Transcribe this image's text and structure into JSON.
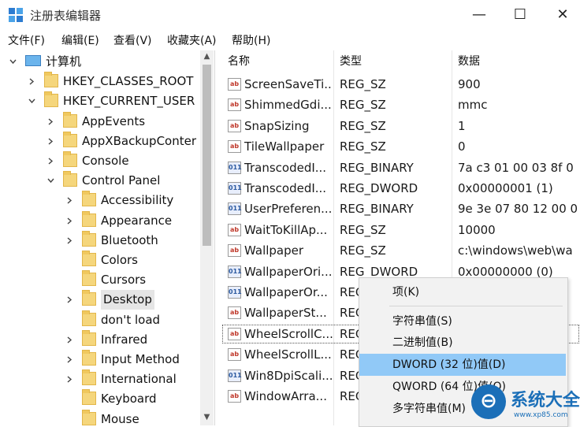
{
  "window": {
    "title": "注册表编辑器",
    "minimize": "—",
    "maximize": "☐",
    "close": "✕"
  },
  "menu": [
    "文件(F)",
    "编辑(E)",
    "查看(V)",
    "收藏夹(A)",
    "帮助(H)"
  ],
  "tree": [
    {
      "label": "计算机",
      "level": 0,
      "toggle": "expanded"
    },
    {
      "label": "HKEY_CLASSES_ROOT",
      "level": 1,
      "toggle": "collapsed"
    },
    {
      "label": "HKEY_CURRENT_USER",
      "level": 1,
      "toggle": "expanded"
    },
    {
      "label": "AppEvents",
      "level": 2,
      "toggle": "collapsed"
    },
    {
      "label": "AppXBackupConter",
      "level": 2,
      "toggle": "collapsed"
    },
    {
      "label": "Console",
      "level": 2,
      "toggle": "collapsed"
    },
    {
      "label": "Control Panel",
      "level": 2,
      "toggle": "expanded"
    },
    {
      "label": "Accessibility",
      "level": 3,
      "toggle": "collapsed"
    },
    {
      "label": "Appearance",
      "level": 3,
      "toggle": "collapsed"
    },
    {
      "label": "Bluetooth",
      "level": 3,
      "toggle": "collapsed"
    },
    {
      "label": "Colors",
      "level": 3,
      "toggle": "none"
    },
    {
      "label": "Cursors",
      "level": 3,
      "toggle": "none"
    },
    {
      "label": "Desktop",
      "level": 3,
      "toggle": "collapsed",
      "selected": true
    },
    {
      "label": "don't load",
      "level": 3,
      "toggle": "none"
    },
    {
      "label": "Infrared",
      "level": 3,
      "toggle": "collapsed"
    },
    {
      "label": "Input Method",
      "level": 3,
      "toggle": "collapsed"
    },
    {
      "label": "International",
      "level": 3,
      "toggle": "collapsed"
    },
    {
      "label": "Keyboard",
      "level": 3,
      "toggle": "none"
    },
    {
      "label": "Mouse",
      "level": 3,
      "toggle": "none"
    }
  ],
  "columns": {
    "name": "名称",
    "type": "类型",
    "data": "数据"
  },
  "values": [
    {
      "name": "ScreenSaveTi...",
      "type": "REG_SZ",
      "data": "900",
      "kind": "sz"
    },
    {
      "name": "ShimmedGdi...",
      "type": "REG_SZ",
      "data": "mmc",
      "kind": "sz"
    },
    {
      "name": "SnapSizing",
      "type": "REG_SZ",
      "data": "1",
      "kind": "sz"
    },
    {
      "name": "TileWallpaper",
      "type": "REG_SZ",
      "data": "0",
      "kind": "sz"
    },
    {
      "name": "TranscodedI...",
      "type": "REG_BINARY",
      "data": "7a c3 01 00 03 8f 0",
      "kind": "bin"
    },
    {
      "name": "TranscodedI...",
      "type": "REG_DWORD",
      "data": "0x00000001 (1)",
      "kind": "bin"
    },
    {
      "name": "UserPreferen...",
      "type": "REG_BINARY",
      "data": "9e 3e 07 80 12 00 0",
      "kind": "bin"
    },
    {
      "name": "WaitToKillAp...",
      "type": "REG_SZ",
      "data": "10000",
      "kind": "sz"
    },
    {
      "name": "Wallpaper",
      "type": "REG_SZ",
      "data": "c:\\windows\\web\\wa",
      "kind": "sz"
    },
    {
      "name": "WallpaperOri...",
      "type": "REG_DWORD",
      "data": "0x00000000 (0)",
      "kind": "bin"
    },
    {
      "name": "WallpaperOr...",
      "type": "REG",
      "data": "",
      "kind": "bin"
    },
    {
      "name": "WallpaperSt...",
      "type": "REG",
      "data": "",
      "kind": "sz"
    },
    {
      "name": "WheelScrollC...",
      "type": "REG",
      "data": "",
      "kind": "sz",
      "focused": true
    },
    {
      "name": "WheelScrollL...",
      "type": "REG",
      "data": "",
      "kind": "sz"
    },
    {
      "name": "Win8DpiScali...",
      "type": "REG",
      "data": "",
      "kind": "bin"
    },
    {
      "name": "WindowArra...",
      "type": "REG",
      "data": "",
      "kind": "sz"
    }
  ],
  "context_menu": [
    {
      "label": "项(K)"
    },
    {
      "label": "字符串值(S)"
    },
    {
      "label": "二进制值(B)"
    },
    {
      "label": "DWORD (32 位)值(D)",
      "highlighted": true
    },
    {
      "label": "QWORD (64 位)值(Q)"
    },
    {
      "label": "多字符串值(M)"
    }
  ],
  "watermark": {
    "text": "系统大全",
    "url": "www.xp85.com"
  }
}
